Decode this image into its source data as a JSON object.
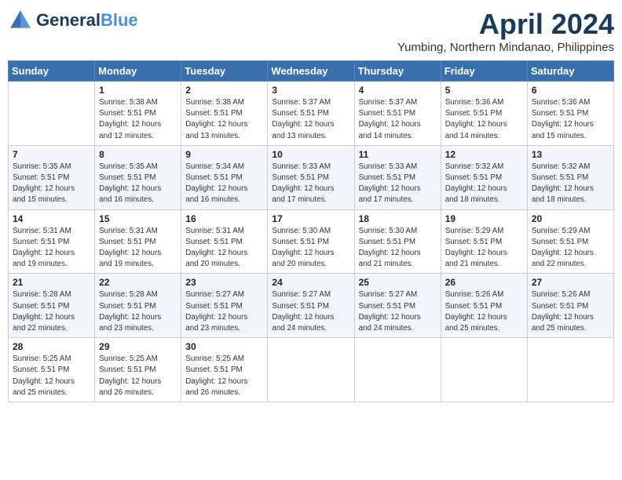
{
  "app": {
    "name": "GeneralBlue",
    "logo_line1": "General",
    "logo_line2": "Blue"
  },
  "calendar": {
    "month": "April 2024",
    "location": "Yumbing, Northern Mindanao, Philippines",
    "days_of_week": [
      "Sunday",
      "Monday",
      "Tuesday",
      "Wednesday",
      "Thursday",
      "Friday",
      "Saturday"
    ],
    "weeks": [
      [
        {
          "day": "",
          "info": ""
        },
        {
          "day": "1",
          "info": "Sunrise: 5:38 AM\nSunset: 5:51 PM\nDaylight: 12 hours\nand 12 minutes."
        },
        {
          "day": "2",
          "info": "Sunrise: 5:38 AM\nSunset: 5:51 PM\nDaylight: 12 hours\nand 13 minutes."
        },
        {
          "day": "3",
          "info": "Sunrise: 5:37 AM\nSunset: 5:51 PM\nDaylight: 12 hours\nand 13 minutes."
        },
        {
          "day": "4",
          "info": "Sunrise: 5:37 AM\nSunset: 5:51 PM\nDaylight: 12 hours\nand 14 minutes."
        },
        {
          "day": "5",
          "info": "Sunrise: 5:36 AM\nSunset: 5:51 PM\nDaylight: 12 hours\nand 14 minutes."
        },
        {
          "day": "6",
          "info": "Sunrise: 5:36 AM\nSunset: 5:51 PM\nDaylight: 12 hours\nand 15 minutes."
        }
      ],
      [
        {
          "day": "7",
          "info": "Sunrise: 5:35 AM\nSunset: 5:51 PM\nDaylight: 12 hours\nand 15 minutes."
        },
        {
          "day": "8",
          "info": "Sunrise: 5:35 AM\nSunset: 5:51 PM\nDaylight: 12 hours\nand 16 minutes."
        },
        {
          "day": "9",
          "info": "Sunrise: 5:34 AM\nSunset: 5:51 PM\nDaylight: 12 hours\nand 16 minutes."
        },
        {
          "day": "10",
          "info": "Sunrise: 5:33 AM\nSunset: 5:51 PM\nDaylight: 12 hours\nand 17 minutes."
        },
        {
          "day": "11",
          "info": "Sunrise: 5:33 AM\nSunset: 5:51 PM\nDaylight: 12 hours\nand 17 minutes."
        },
        {
          "day": "12",
          "info": "Sunrise: 5:32 AM\nSunset: 5:51 PM\nDaylight: 12 hours\nand 18 minutes."
        },
        {
          "day": "13",
          "info": "Sunrise: 5:32 AM\nSunset: 5:51 PM\nDaylight: 12 hours\nand 18 minutes."
        }
      ],
      [
        {
          "day": "14",
          "info": "Sunrise: 5:31 AM\nSunset: 5:51 PM\nDaylight: 12 hours\nand 19 minutes."
        },
        {
          "day": "15",
          "info": "Sunrise: 5:31 AM\nSunset: 5:51 PM\nDaylight: 12 hours\nand 19 minutes."
        },
        {
          "day": "16",
          "info": "Sunrise: 5:31 AM\nSunset: 5:51 PM\nDaylight: 12 hours\nand 20 minutes."
        },
        {
          "day": "17",
          "info": "Sunrise: 5:30 AM\nSunset: 5:51 PM\nDaylight: 12 hours\nand 20 minutes."
        },
        {
          "day": "18",
          "info": "Sunrise: 5:30 AM\nSunset: 5:51 PM\nDaylight: 12 hours\nand 21 minutes."
        },
        {
          "day": "19",
          "info": "Sunrise: 5:29 AM\nSunset: 5:51 PM\nDaylight: 12 hours\nand 21 minutes."
        },
        {
          "day": "20",
          "info": "Sunrise: 5:29 AM\nSunset: 5:51 PM\nDaylight: 12 hours\nand 22 minutes."
        }
      ],
      [
        {
          "day": "21",
          "info": "Sunrise: 5:28 AM\nSunset: 5:51 PM\nDaylight: 12 hours\nand 22 minutes."
        },
        {
          "day": "22",
          "info": "Sunrise: 5:28 AM\nSunset: 5:51 PM\nDaylight: 12 hours\nand 23 minutes."
        },
        {
          "day": "23",
          "info": "Sunrise: 5:27 AM\nSunset: 5:51 PM\nDaylight: 12 hours\nand 23 minutes."
        },
        {
          "day": "24",
          "info": "Sunrise: 5:27 AM\nSunset: 5:51 PM\nDaylight: 12 hours\nand 24 minutes."
        },
        {
          "day": "25",
          "info": "Sunrise: 5:27 AM\nSunset: 5:51 PM\nDaylight: 12 hours\nand 24 minutes."
        },
        {
          "day": "26",
          "info": "Sunrise: 5:26 AM\nSunset: 5:51 PM\nDaylight: 12 hours\nand 25 minutes."
        },
        {
          "day": "27",
          "info": "Sunrise: 5:26 AM\nSunset: 5:51 PM\nDaylight: 12 hours\nand 25 minutes."
        }
      ],
      [
        {
          "day": "28",
          "info": "Sunrise: 5:25 AM\nSunset: 5:51 PM\nDaylight: 12 hours\nand 25 minutes."
        },
        {
          "day": "29",
          "info": "Sunrise: 5:25 AM\nSunset: 5:51 PM\nDaylight: 12 hours\nand 26 minutes."
        },
        {
          "day": "30",
          "info": "Sunrise: 5:25 AM\nSunset: 5:51 PM\nDaylight: 12 hours\nand 26 minutes."
        },
        {
          "day": "",
          "info": ""
        },
        {
          "day": "",
          "info": ""
        },
        {
          "day": "",
          "info": ""
        },
        {
          "day": "",
          "info": ""
        }
      ]
    ]
  }
}
